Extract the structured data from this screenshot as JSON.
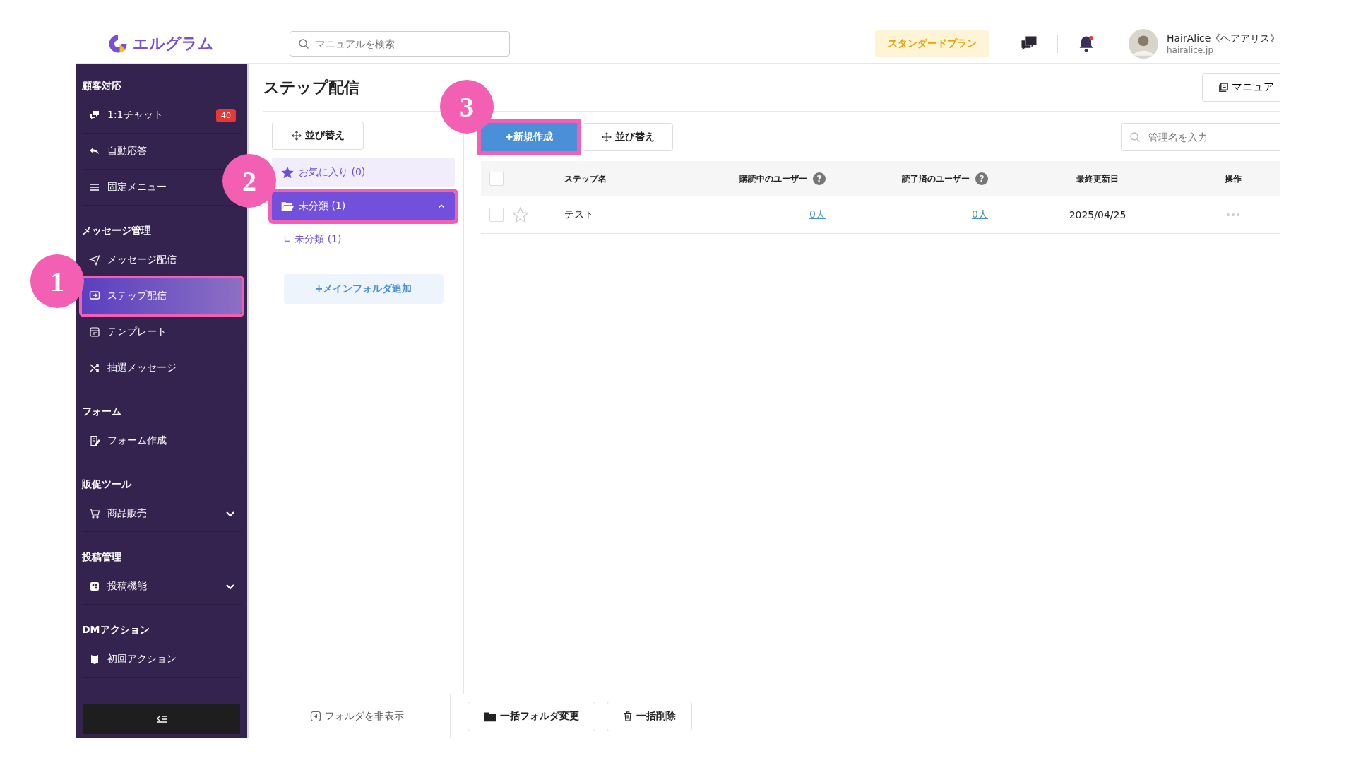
{
  "header": {
    "logo": "エルグラム",
    "search": {
      "placeholder": "マニュアルを検索"
    },
    "plan": "スタンダードプラン",
    "user": {
      "name": "HairAlice《ヘアアリス》",
      "domain": "hairalice.jp"
    }
  },
  "sidebar": {
    "sections": [
      {
        "title": "顧客対応",
        "items": [
          {
            "label": "1:1チャット",
            "kind": "link",
            "badge": "40",
            "selected": false,
            "highlighted": false
          },
          {
            "label": "自動応答",
            "kind": "link",
            "selected": false,
            "highlighted": false
          },
          {
            "label": "固定メニュー",
            "kind": "link",
            "selected": false,
            "highlighted": false
          }
        ]
      },
      {
        "title": "メッセージ管理",
        "items": [
          {
            "label": "メッセージ配信",
            "kind": "link",
            "selected": false,
            "highlighted": false
          },
          {
            "label": "ステップ配信",
            "kind": "link",
            "selected": true,
            "highlighted": true
          },
          {
            "label": "テンプレート",
            "kind": "link",
            "selected": false,
            "highlighted": false
          },
          {
            "label": "抽選メッセージ",
            "kind": "link",
            "selected": false,
            "highlighted": false
          }
        ]
      },
      {
        "title": "フォーム",
        "items": [
          {
            "label": "フォーム作成",
            "kind": "link",
            "selected": false,
            "highlighted": false
          }
        ]
      },
      {
        "title": "販促ツール",
        "items": [
          {
            "label": "商品販売",
            "kind": "group",
            "selected": false,
            "highlighted": false
          }
        ]
      },
      {
        "title": "投稿管理",
        "items": [
          {
            "label": "投稿機能",
            "kind": "group",
            "selected": false,
            "highlighted": false
          }
        ]
      },
      {
        "title": "DMアクション",
        "items": [
          {
            "label": "初回アクション",
            "kind": "link",
            "selected": false,
            "highlighted": false
          }
        ]
      }
    ]
  },
  "page": {
    "title": "ステップ配信",
    "manual_button": "マニュア"
  },
  "folders": {
    "sort_button": "並び替え",
    "items": [
      {
        "label": "お気に入り (0)",
        "kind": "favorite",
        "selected": false,
        "highlighted": false
      },
      {
        "label": "未分類 (1)",
        "kind": "folder",
        "selected": true,
        "expanded": true,
        "highlighted": true,
        "children": [
          {
            "label": "∟ 未分類 (1)"
          }
        ]
      }
    ],
    "add_button": "+メインフォルダ追加",
    "hide_button": "フォルダを非表示"
  },
  "toolbar": {
    "new_button": {
      "label": "+新規作成",
      "highlighted": true
    },
    "sort_button": "並び替え",
    "search": {
      "placeholder": "管理名を入力"
    }
  },
  "table": {
    "all_checked": false,
    "columns": [
      {
        "label": "ステップ名"
      },
      {
        "label": "購読中のユーザー",
        "help": "?"
      },
      {
        "label": "読了済のユーザー",
        "help": "?"
      },
      {
        "label": "最終更新日"
      },
      {
        "label": "操作"
      }
    ],
    "rows": [
      {
        "checked": false,
        "favorite": false,
        "name": "テスト",
        "subscribers": "0人",
        "completed": "0人",
        "updated": "2025/04/25"
      }
    ]
  },
  "bulk_actions": {
    "folder_button": "一括フォルダ変更",
    "delete_button": "一括削除"
  },
  "annotations": [
    {
      "number": "1"
    },
    {
      "number": "2"
    },
    {
      "number": "3"
    }
  ]
}
